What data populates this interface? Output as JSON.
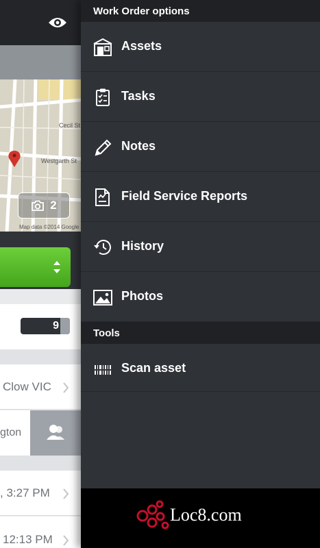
{
  "background_screen": {
    "photo_count": "2",
    "map_credit": "Map data ©2014 Google",
    "map_streets": [
      "Cecil St",
      "Westgarth St"
    ],
    "counter_value": "9",
    "row_texts": [
      "Clow VIC",
      "gton",
      ", 3:27 PM",
      "12:13 PM"
    ]
  },
  "drawer": {
    "work_order_header": "Work Order options",
    "items": [
      {
        "label": "Assets",
        "icon": "assets-icon"
      },
      {
        "label": "Tasks",
        "icon": "clipboard-icon"
      },
      {
        "label": "Notes",
        "icon": "pencil-icon"
      },
      {
        "label": "Field Service Reports",
        "icon": "report-icon"
      },
      {
        "label": "History",
        "icon": "history-icon"
      },
      {
        "label": "Photos",
        "icon": "photo-icon"
      }
    ],
    "tools_header": "Tools",
    "tools": [
      {
        "label": "Scan asset",
        "icon": "barcode-icon"
      }
    ]
  },
  "footer": {
    "brand": "Loc8.com"
  },
  "colors": {
    "drawer_bg": "#2f3237",
    "header_bg": "#1f2124",
    "accent_green": "#55b526",
    "brand_red": "#c4102a"
  }
}
